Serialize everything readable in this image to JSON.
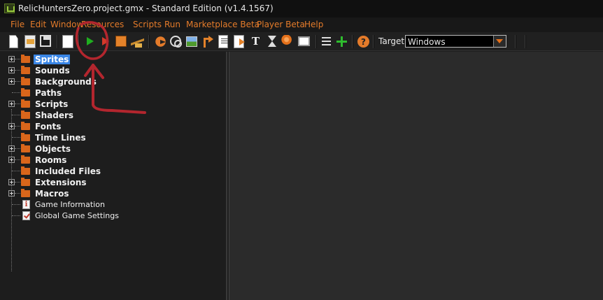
{
  "titlebar": {
    "title": "RelicHuntersZero.project.gmx  -  Standard Edition (v1.4.1567)"
  },
  "menu": [
    {
      "key": "file",
      "label": "File"
    },
    {
      "key": "edit",
      "label": "Edit"
    },
    {
      "key": "window",
      "label": "Window"
    },
    {
      "key": "resources",
      "label": "Resources"
    },
    {
      "key": "scripts",
      "label": "Scripts"
    },
    {
      "key": "run",
      "label": "Run"
    },
    {
      "key": "marketplace-beta",
      "label": "Marketplace Beta"
    },
    {
      "key": "player-beta",
      "label": "Player Beta"
    },
    {
      "key": "help",
      "label": "Help"
    }
  ],
  "toolbar": {
    "icons": [
      "new-project-icon",
      "open-project-icon",
      "save-project-icon",
      "export-project-icon",
      "run-game-icon",
      "debug-game-icon",
      "create-executable-icon",
      "clean-build-icon",
      "create-sprite-icon",
      "create-sound-icon",
      "create-background-icon",
      "create-path-icon",
      "create-script-icon",
      "create-shader-icon",
      "create-font-icon",
      "create-timeline-icon",
      "create-object-icon",
      "create-room-icon",
      "global-settings-icon",
      "add-extension-icon",
      "help-icon"
    ],
    "font_glyph": "T",
    "help_glyph": "?",
    "target_label": "Target:",
    "target_value": "Windows"
  },
  "tree": {
    "items": [
      {
        "label": "Sprites",
        "expandable": true,
        "selected": true
      },
      {
        "label": "Sounds",
        "expandable": true
      },
      {
        "label": "Backgrounds",
        "expandable": true
      },
      {
        "label": "Paths",
        "expandable": false
      },
      {
        "label": "Scripts",
        "expandable": true
      },
      {
        "label": "Shaders",
        "expandable": false
      },
      {
        "label": "Fonts",
        "expandable": true
      },
      {
        "label": "Time Lines",
        "expandable": false
      },
      {
        "label": "Objects",
        "expandable": true
      },
      {
        "label": "Rooms",
        "expandable": true
      },
      {
        "label": "Included Files",
        "expandable": false
      },
      {
        "label": "Extensions",
        "expandable": true
      },
      {
        "label": "Macros",
        "expandable": true
      },
      {
        "label": "Game Information",
        "icon": "info-icon"
      },
      {
        "label": "Global Game Settings",
        "icon": "settings-check-icon"
      }
    ]
  },
  "colors": {
    "menu_text": "#e47b2a",
    "folder": "#d9661b",
    "selection": "#3a86e6",
    "annotation": "#b3262e"
  },
  "annotation": {
    "description": "hand-drawn-circle-and-arrow-pointing-to-run-button"
  }
}
